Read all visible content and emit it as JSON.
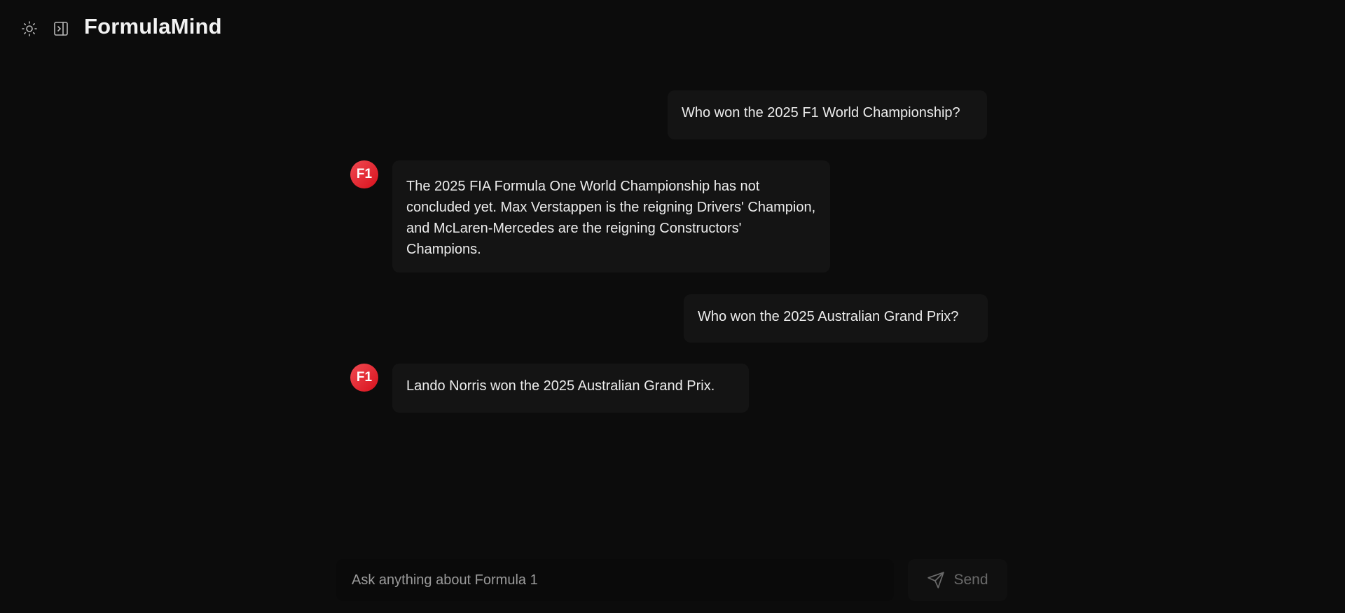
{
  "header": {
    "brand": "FormulaMind",
    "theme_icon": "sun-icon",
    "sidebar_icon": "sidebar-toggle-icon"
  },
  "messages": [
    {
      "role": "user",
      "text": "Who won the 2025 F1 World Championship?"
    },
    {
      "role": "assistant",
      "avatar": "F1",
      "text": "The 2025 FIA Formula One World Championship has not concluded yet. Max Verstappen is the reigning Drivers' Champion, and McLaren-Mercedes are the reigning Constructors' Champions."
    },
    {
      "role": "user",
      "text": "Who won the 2025 Australian Grand Prix?"
    },
    {
      "role": "assistant",
      "avatar": "F1",
      "text": "Lando Norris won the 2025 Australian Grand Prix."
    }
  ],
  "composer": {
    "placeholder": "Ask anything about Formula 1",
    "value": "",
    "send_label": "Send",
    "send_icon": "send-plane-icon"
  },
  "colors": {
    "background": "#0c0c0c",
    "bubble": "#141414",
    "avatar_start": "#f04a52",
    "avatar_end": "#d8111c"
  }
}
